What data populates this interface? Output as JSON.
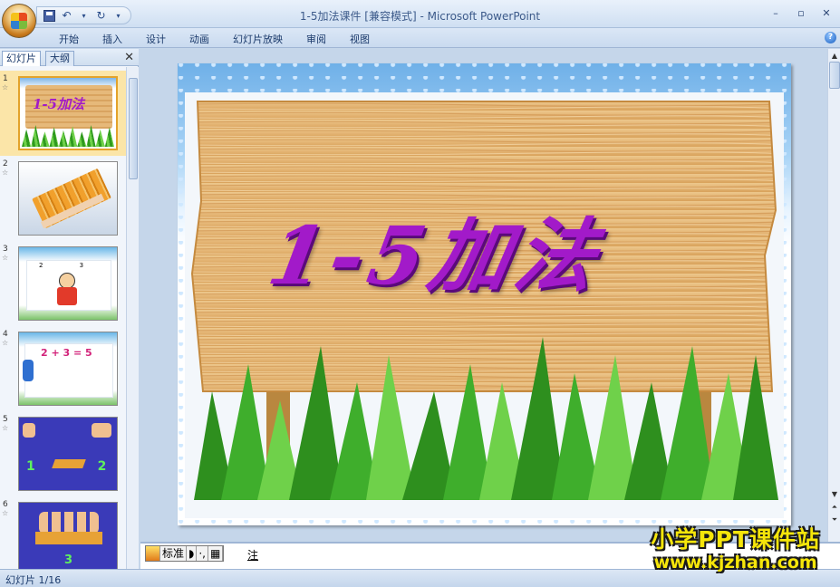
{
  "window": {
    "title": "1-5加法课件 [兼容模式] - Microsoft PowerPoint",
    "controls": [
      "–",
      "▫",
      "✕"
    ]
  },
  "ribbon": {
    "tabs": [
      "开始",
      "插入",
      "设计",
      "动画",
      "幻灯片放映",
      "审阅",
      "视图"
    ],
    "help": "?"
  },
  "left_panel": {
    "tabs": [
      "幻灯片",
      "大纲"
    ],
    "close": "✕",
    "thumbnails": [
      {
        "number": "1",
        "label": "1-5加法"
      },
      {
        "number": "2",
        "label": ""
      },
      {
        "number": "3",
        "label": "2 3"
      },
      {
        "number": "4",
        "label": "2 + 3 = 5"
      },
      {
        "number": "5",
        "label": "1 2"
      },
      {
        "number": "6",
        "label": "3"
      }
    ],
    "selected_index": 0
  },
  "slide": {
    "title": "1-5加法"
  },
  "notes": {
    "ime_mode": "标准",
    "text": "注"
  },
  "status": {
    "slide_position": "幻灯片 1/16"
  },
  "watermark": {
    "line1": "小学PPT课件站",
    "line2": "www.kjzhan.com"
  },
  "colors": {
    "title_purple": "#a21ac9",
    "wood": "#e6b97a",
    "grass": "#3fae2c",
    "selected_thumb": "#fbe5a8"
  }
}
